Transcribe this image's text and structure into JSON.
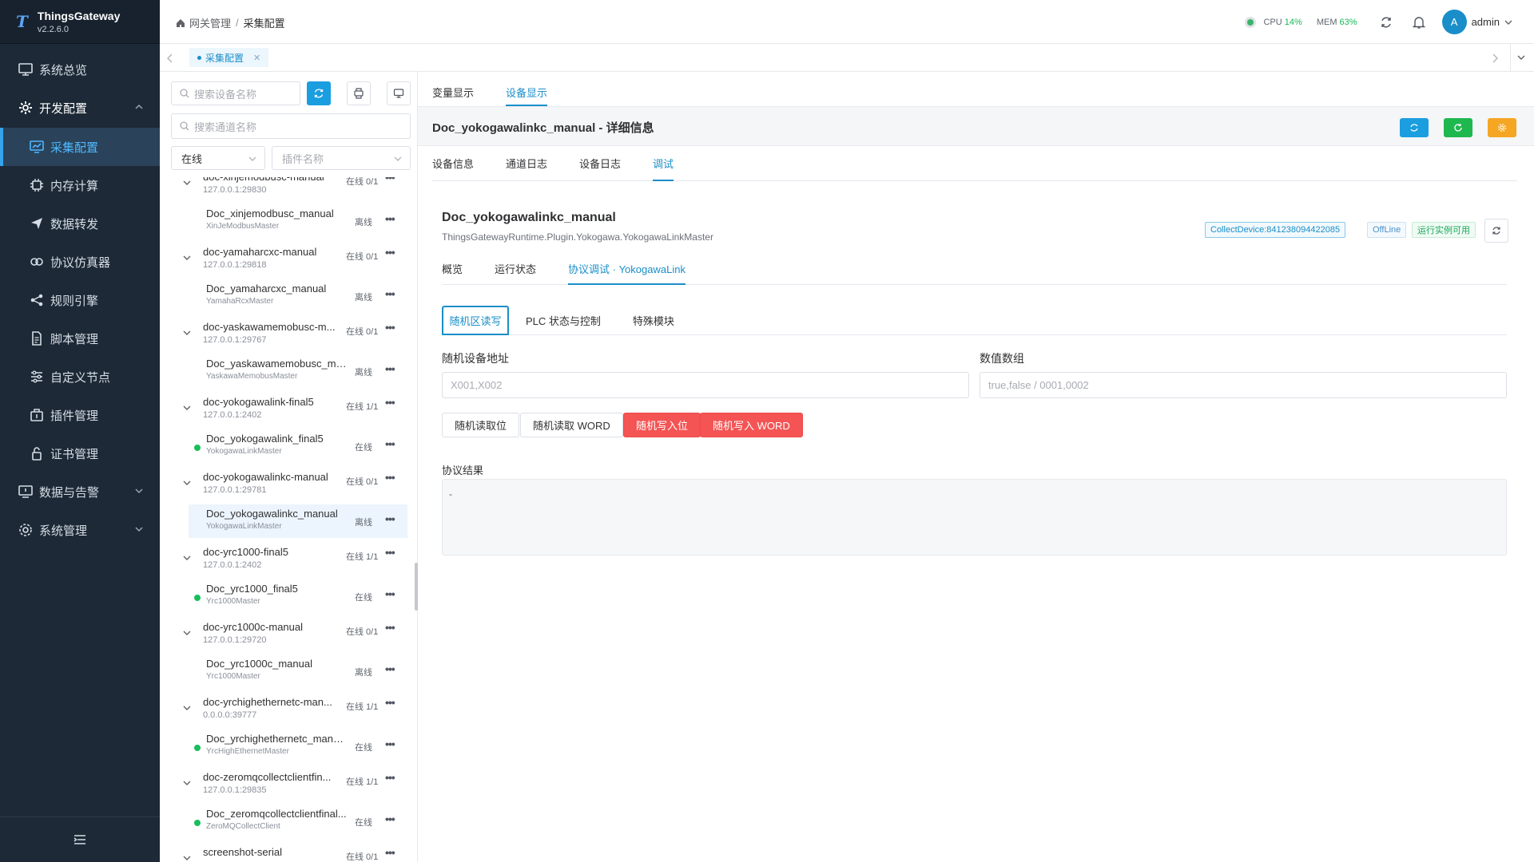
{
  "app": {
    "name": "ThingsGateway",
    "version": "v2.2.6.0",
    "logo_letter": "T"
  },
  "sidebar": {
    "items": [
      {
        "label": "系统总览",
        "icon": "monitor-icon"
      },
      {
        "label": "开发配置",
        "icon": "gear-icon"
      },
      {
        "label": "采集配置",
        "icon": "chart-board-icon"
      },
      {
        "label": "内存计算",
        "icon": "cpu-icon"
      },
      {
        "label": "数据转发",
        "icon": "send-icon"
      },
      {
        "label": "协议仿真器",
        "icon": "link-icon"
      },
      {
        "label": "规则引擎",
        "icon": "share-icon"
      },
      {
        "label": "脚本管理",
        "icon": "document-icon"
      },
      {
        "label": "自定义节点",
        "icon": "sliders-icon"
      },
      {
        "label": "插件管理",
        "icon": "box-icon"
      },
      {
        "label": "证书管理",
        "icon": "lock-icon"
      },
      {
        "label": "数据与告警",
        "icon": "alert-monitor-icon"
      },
      {
        "label": "系统管理",
        "icon": "settings-icon"
      }
    ]
  },
  "header": {
    "breadcrumb": [
      "网关管理",
      "采集配置"
    ],
    "cpu_label": "CPU",
    "cpu_value": "14%",
    "mem_label": "MEM",
    "mem_value": "63%",
    "user": "admin",
    "avatar_letter": "A"
  },
  "page_tabs": [
    {
      "label": "采集配置"
    }
  ],
  "left": {
    "search_device_placeholder": "搜索设备名称",
    "search_channel_placeholder": "搜索通道名称",
    "status_select": "在线",
    "plugin_placeholder": "插件名称",
    "groups": [
      {
        "name": "doc-xinjemodbusc-manual",
        "addr": "127.0.0.1:29830",
        "status": "在线 0/1",
        "device": {
          "name": "Doc_xinjemodbusc_manual",
          "type": "XinJeModbusMaster",
          "status": "离线"
        }
      },
      {
        "name": "doc-yamaharcxc-manual",
        "addr": "127.0.0.1:29818",
        "status": "在线 0/1",
        "device": {
          "name": "Doc_yamaharcxc_manual",
          "type": "YamahaRcxMaster",
          "status": "离线"
        }
      },
      {
        "name": "doc-yaskawamemobusc-m...",
        "addr": "127.0.0.1:29767",
        "status": "在线 0/1",
        "device": {
          "name": "Doc_yaskawamemobusc_ma...",
          "type": "YaskawaMemobusMaster",
          "status": "离线"
        }
      },
      {
        "name": "doc-yokogawalink-final5",
        "addr": "127.0.0.1:2402",
        "status": "在线 1/1",
        "device": {
          "name": "Doc_yokogawalink_final5",
          "type": "YokogawaLinkMaster",
          "status": "在线"
        }
      },
      {
        "name": "doc-yokogawalinkc-manual",
        "addr": "127.0.0.1:29781",
        "status": "在线 0/1",
        "device": {
          "name": "Doc_yokogawalinkc_manual",
          "type": "YokogawaLinkMaster",
          "status": "离线"
        }
      },
      {
        "name": "doc-yrc1000-final5",
        "addr": "127.0.0.1:2402",
        "status": "在线 1/1",
        "device": {
          "name": "Doc_yrc1000_final5",
          "type": "Yrc1000Master",
          "status": "在线"
        }
      },
      {
        "name": "doc-yrc1000c-manual",
        "addr": "127.0.0.1:29720",
        "status": "在线 0/1",
        "device": {
          "name": "Doc_yrc1000c_manual",
          "type": "Yrc1000Master",
          "status": "离线"
        }
      },
      {
        "name": "doc-yrchighethernetc-man...",
        "addr": "0.0.0.0:39777",
        "status": "在线 1/1",
        "device": {
          "name": "Doc_yrchighethernetc_manual",
          "type": "YrcHighEthernetMaster",
          "status": "在线"
        }
      },
      {
        "name": "doc-zeromqcollectclientfin...",
        "addr": "127.0.0.1:29835",
        "status": "在线 1/1",
        "device": {
          "name": "Doc_zeromqcollectclientfinal...",
          "type": "ZeroMQCollectClient",
          "status": "在线"
        }
      },
      {
        "name": "screenshot-serial",
        "addr": "",
        "status": "在线 0/1",
        "device": null
      }
    ]
  },
  "main": {
    "top_tabs": [
      "变量显示",
      "设备显示"
    ],
    "detail_title": "Doc_yokogawalinkc_manual - 详细信息",
    "sub_tabs": [
      "设备信息",
      "通道日志",
      "设备日志",
      "调试"
    ],
    "device_name": "Doc_yokogawalinkc_manual",
    "device_class": "ThingsGatewayRuntime.Plugin.Yokogawa.YokogawaLinkMaster",
    "badges": {
      "collect": "CollectDevice:841238094422085",
      "offline": "OffLine",
      "runtime": "运行实例可用"
    },
    "proto_tabs": [
      "概览",
      "运行状态",
      "协议调试 · YokogawaLink"
    ],
    "rw_tabs": [
      "随机区读写",
      "PLC 状态与控制",
      "特殊模块"
    ],
    "addr_label": "随机设备地址",
    "addr_placeholder": "X001,X002",
    "value_label": "数值数组",
    "value_placeholder": "true,false / 0001,0002",
    "buttons": [
      "随机读取位",
      "随机读取 WORD",
      "随机写入位",
      "随机写入 WORD"
    ],
    "result_label": "协议结果",
    "result_text": "-"
  },
  "colors": {
    "accent": "#1a8ec8",
    "sidebar_bg": "#1d2936",
    "online": "#19be5c",
    "danger": "#f45454",
    "warning": "#f5a623"
  }
}
